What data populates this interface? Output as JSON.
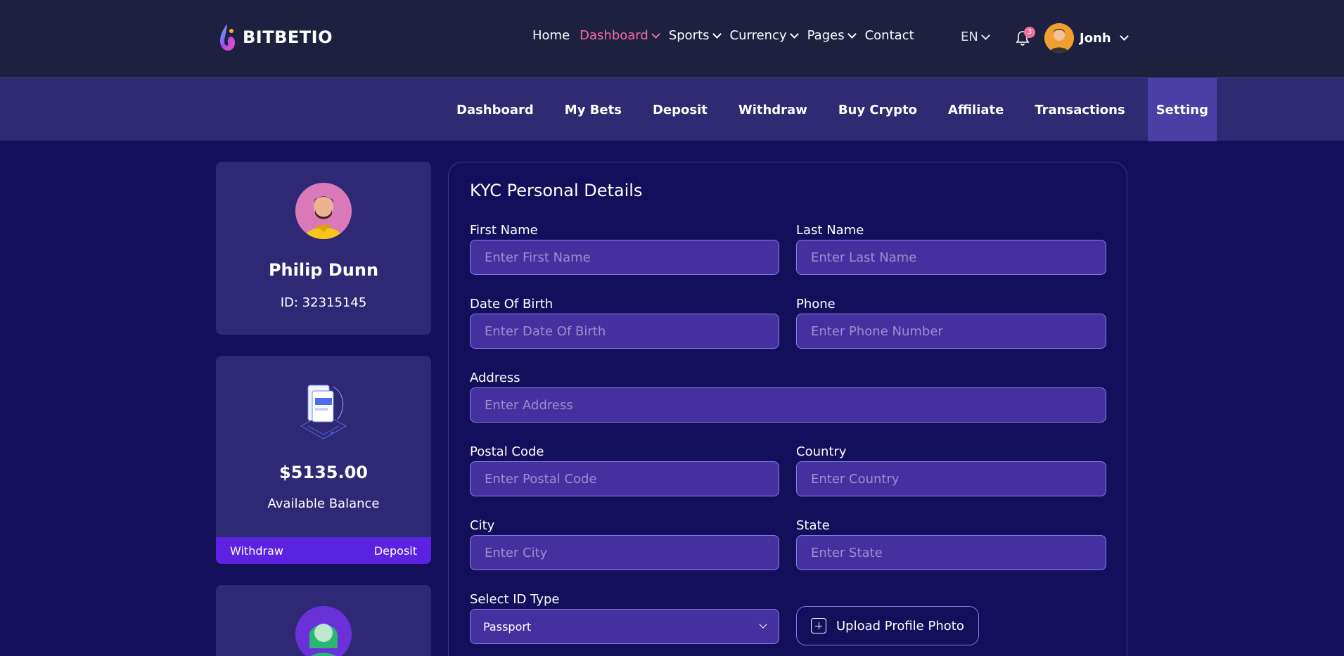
{
  "brand": {
    "name": "BITBETIO",
    "logo_icon": "flame-logo-icon"
  },
  "main_nav": [
    {
      "label": "Home",
      "active": false,
      "has_dropdown": false
    },
    {
      "label": "Dashboard",
      "active": true,
      "has_dropdown": true
    },
    {
      "label": "Sports",
      "active": false,
      "has_dropdown": true
    },
    {
      "label": "Currency",
      "active": false,
      "has_dropdown": true
    },
    {
      "label": "Pages",
      "active": false,
      "has_dropdown": true
    },
    {
      "label": "Contact",
      "active": false,
      "has_dropdown": false
    }
  ],
  "language": {
    "value": "EN"
  },
  "notifications": {
    "count": "3",
    "icon": "bell-icon"
  },
  "user": {
    "name": "Jonh"
  },
  "sub_nav": [
    {
      "label": "Dashboard",
      "active": false
    },
    {
      "label": "My Bets",
      "active": false
    },
    {
      "label": "Deposit",
      "active": false
    },
    {
      "label": "Withdraw",
      "active": false
    },
    {
      "label": "Buy Crypto",
      "active": false
    },
    {
      "label": "Affiliate",
      "active": false
    },
    {
      "label": "Transactions",
      "active": false
    },
    {
      "label": "Setting",
      "active": true
    }
  ],
  "profile": {
    "name": "Philip Dunn",
    "id_text": "ID: 32315145"
  },
  "balance": {
    "amount": "$5135.00",
    "label": "Available Balance",
    "withdraw_label": "Withdraw",
    "deposit_label": "Deposit"
  },
  "kyc": {
    "title": "KYC Personal Details",
    "first_name": {
      "label": "First Name",
      "placeholder": "Enter First Name",
      "value": ""
    },
    "last_name": {
      "label": "Last Name",
      "placeholder": "Enter Last Name",
      "value": ""
    },
    "dob": {
      "label": "Date Of Birth",
      "placeholder": "Enter Date Of Birth",
      "value": ""
    },
    "phone": {
      "label": "Phone",
      "placeholder": "Enter Phone Number",
      "value": ""
    },
    "address": {
      "label": "Address",
      "placeholder": "Enter Address",
      "value": ""
    },
    "postal_code": {
      "label": "Postal Code",
      "placeholder": "Enter Postal Code",
      "value": ""
    },
    "country": {
      "label": "Country",
      "placeholder": "Enter Country",
      "value": ""
    },
    "city": {
      "label": "City",
      "placeholder": "Enter City",
      "value": ""
    },
    "state": {
      "label": "State",
      "placeholder": "Enter State",
      "value": ""
    },
    "id_type": {
      "label": "Select ID Type",
      "selected": "Passport"
    },
    "upload_label": "Upload Profile Photo"
  },
  "colors": {
    "header_bg": "#1e2040",
    "subnav_bg": "#302a73",
    "page_bg": "#140f5a",
    "card_bg": "#2f2875",
    "accent_pink": "#f2709c",
    "accent_purple": "#5b22e2",
    "input_bg": "#4530a0"
  }
}
